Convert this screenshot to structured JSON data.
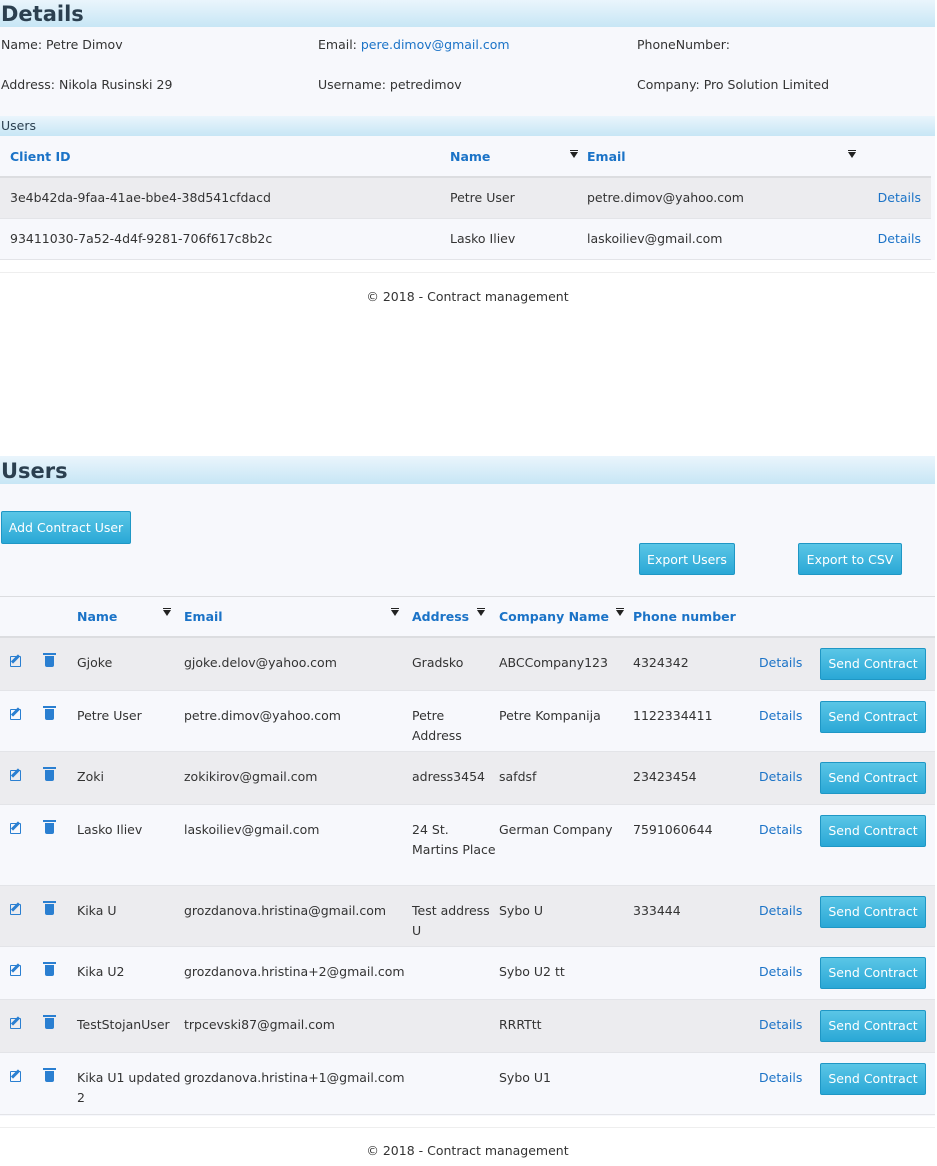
{
  "details": {
    "title": "Details",
    "name": "Name: Petre Dimov",
    "email_label": "Email: ",
    "email_value": "pere.dimov@gmail.com",
    "phone": "PhoneNumber:",
    "address": "Address: Nikola Rusinski 29",
    "username": "Username: petredimov",
    "company": "Company: Pro Solution Limited"
  },
  "client_users": {
    "title": "Users",
    "headers": [
      "Client ID",
      "Name",
      "Email"
    ],
    "rows": [
      {
        "client_id": "3e4b42da-9faa-41ae-bbe4-38d541cfdacd",
        "name": "Petre User",
        "email": "petre.dimov@yahoo.com",
        "action": "Details"
      },
      {
        "client_id": "93411030-7a52-4d4f-9281-706f617c8b2c",
        "name": "Lasko Iliev",
        "email": "laskoiliev@gmail.com",
        "action": "Details"
      }
    ]
  },
  "footer_text": "© 2018 - Contract management",
  "users_page": {
    "title": "Users",
    "add_button": "Add Contract User",
    "export_users_button": "Export Users",
    "export_csv_button": "Export to CSV",
    "headers": [
      "Name",
      "Email",
      "Address",
      "Company Name",
      "Phone number"
    ],
    "rows": [
      {
        "name": "Gjoke",
        "email": "gjoke.delov@yahoo.com",
        "address": "Gradsko",
        "company": "ABCCompany123",
        "phone": "4324342"
      },
      {
        "name": "Petre User",
        "email": "petre.dimov@yahoo.com",
        "address": "Petre Address",
        "company": "Petre Kompanija",
        "phone": "1122334411"
      },
      {
        "name": "Zoki",
        "email": "zokikirov@gmail.com",
        "address": "adress3454",
        "company": "safdsf",
        "phone": "23423454"
      },
      {
        "name": "Lasko Iliev",
        "email": "laskoiliev@gmail.com",
        "address": "24 St. Martins Place",
        "company": "German Company",
        "phone": "7591060644"
      },
      {
        "name": "Kika U",
        "email": "grozdanova.hristina@gmail.com",
        "address": "Test address U",
        "company": "Sybo U",
        "phone": "333444"
      },
      {
        "name": "Kika U2",
        "email": "grozdanova.hristina+2@gmail.com",
        "address": "",
        "company": "Sybo U2 tt",
        "phone": ""
      },
      {
        "name": "TestStojanUser",
        "email": "trpcevski87@gmail.com",
        "address": "",
        "company": "RRRTtt",
        "phone": ""
      },
      {
        "name": "Kika U1 updated 2",
        "email": "grozdanova.hristina+1@gmail.com",
        "address": "",
        "company": "Sybo U1",
        "phone": ""
      }
    ],
    "details_label": "Details",
    "send_label": "Send Contract"
  },
  "icons": {
    "edit": "edit-icon",
    "delete": "trash-icon",
    "filter": "filter-icon"
  },
  "colors": {
    "accent": "#1b73c7",
    "button": "#2aa8d6",
    "header_gradient_end": "#c7e6f5"
  }
}
